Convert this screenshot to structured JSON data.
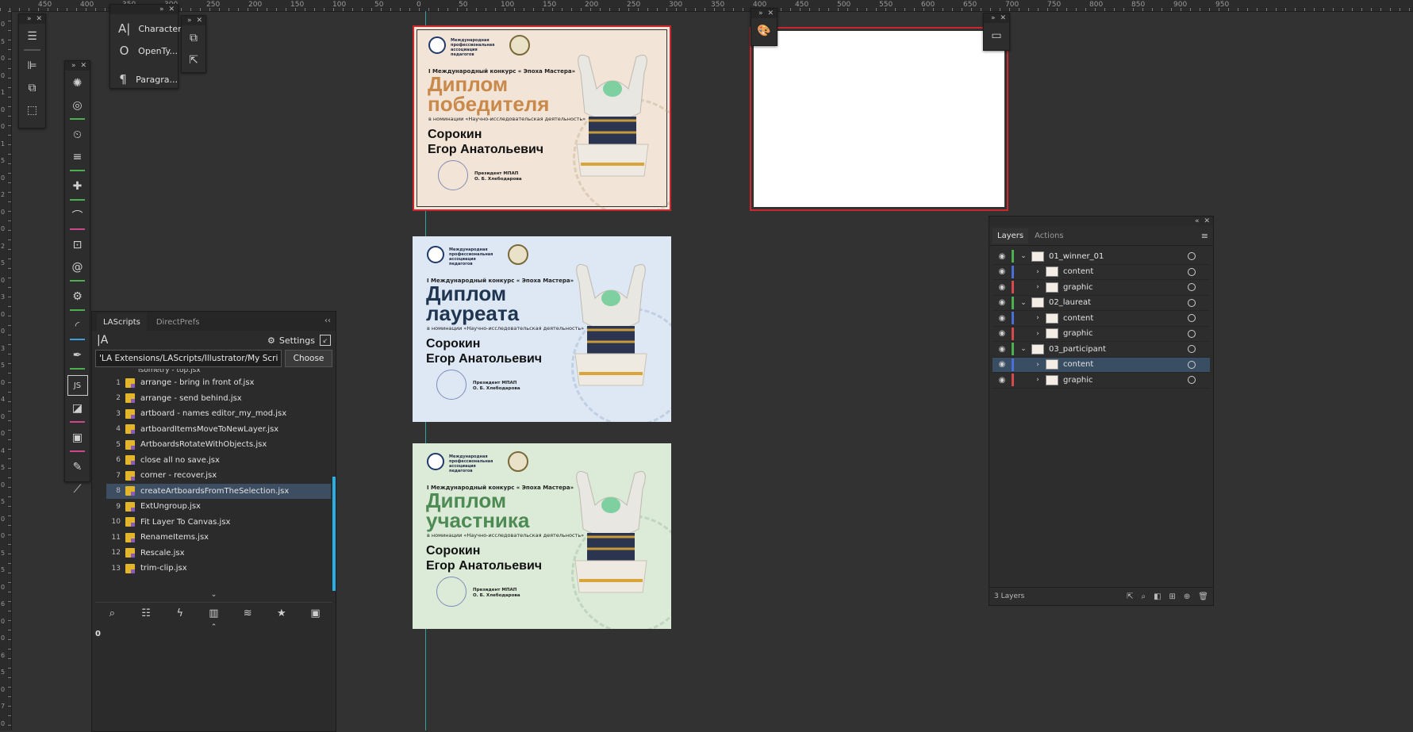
{
  "ruler": {
    "top_labels": [
      "450",
      "400",
      "350",
      "300",
      "250",
      "200",
      "150",
      "100",
      "50",
      "0",
      "50",
      "100",
      "150",
      "200",
      "250",
      "300",
      "350",
      "400",
      "450",
      "500",
      "550",
      "600",
      "650",
      "700",
      "750",
      "800",
      "850",
      "900",
      "950"
    ],
    "left_labels": [
      "0",
      "5",
      "0",
      "0",
      "1",
      "0",
      "0",
      "1",
      "5",
      "0",
      "2",
      "0",
      "0",
      "2",
      "5",
      "0",
      "3",
      "0",
      "0",
      "3",
      "5",
      "0",
      "4",
      "0",
      "0",
      "4",
      "5",
      "0",
      "5",
      "0",
      "0",
      "5",
      "5",
      "0",
      "6",
      "0",
      "0",
      "6",
      "5",
      "0",
      "7",
      "0"
    ]
  },
  "type_panel": {
    "items": [
      {
        "icon": "A|",
        "label": "Character"
      },
      {
        "icon": "O",
        "label": "OpenTy..."
      },
      {
        "icon": "¶",
        "label": "Paragra..."
      }
    ]
  },
  "artboards": [
    {
      "contest": "I Международный конкурс « Эпоха Мастера»",
      "title_line1": "Диплом",
      "title_line2": "победителя",
      "title_color": "#c8894a",
      "bg": "#f2e4d6",
      "nomination": "в номинации «Научно-исследовательская деятельность»",
      "name_line1": "Сорокин",
      "name_line2": "Егор Анатольевич",
      "sig_role": "Президент МПАП",
      "sig_name": "О. Б. Хлебодарова",
      "org": "Международная профессиональная ассоциация педагогов"
    },
    {
      "contest": "I Международный конкурс « Эпоха Мастера»",
      "title_line1": "Диплом",
      "title_line2": "лауреата",
      "title_color": "#1f3550",
      "bg": "#dde8f4",
      "nomination": "в номинации «Научно-исследовательская деятельность»",
      "name_line1": "Сорокин",
      "name_line2": "Егор Анатольевич",
      "sig_role": "Президент МПАП",
      "sig_name": "О. Б. Хлебодарова",
      "org": "Международная профессиональная ассоциация педагогов"
    },
    {
      "contest": "I Международный конкурс « Эпоха Мастера»",
      "title_line1": "Диплом",
      "title_line2": "участника",
      "title_color": "#4e8a54",
      "bg": "#dcebd8",
      "nomination": "в номинации «Научно-исследовательская деятельность»",
      "name_line1": "Сорокин",
      "name_line2": "Егор Анатольевич",
      "sig_role": "Президент МПАП",
      "sig_name": "О. Б. Хлебодарова",
      "org": "Международная профессиональная ассоциация педагогов"
    }
  ],
  "lascripts": {
    "tabs": [
      "LAScripts",
      "DirectPrefs"
    ],
    "settings_label": "Settings",
    "path_value": "'LA Extensions/LAScripts/Illustrator/My Scripts",
    "choose_label": "Choose",
    "partial_item": "isometry - top.jsx",
    "scripts": [
      {
        "num": "1",
        "name": "arrange - bring in front of.jsx"
      },
      {
        "num": "2",
        "name": "arrange - send behind.jsx"
      },
      {
        "num": "3",
        "name": "artboard - names editor_my_mod.jsx"
      },
      {
        "num": "4",
        "name": "artboardItemsMoveToNewLayer.jsx"
      },
      {
        "num": "5",
        "name": "ArtboardsRotateWithObjects.jsx"
      },
      {
        "num": "6",
        "name": "close all no save.jsx"
      },
      {
        "num": "7",
        "name": "corner - recover.jsx"
      },
      {
        "num": "8",
        "name": "createArtboardsFromTheSelection.jsx"
      },
      {
        "num": "9",
        "name": "ExtUngroup.jsx"
      },
      {
        "num": "10",
        "name": "Fit Layer To Canvas.jsx"
      },
      {
        "num": "11",
        "name": "RenameItems.jsx"
      },
      {
        "num": "12",
        "name": "Rescale.jsx"
      },
      {
        "num": "13",
        "name": "trim-clip.jsx"
      }
    ],
    "selected_index": 7,
    "status_value": "0"
  },
  "layers_panel": {
    "tabs": [
      "Layers",
      "Actions"
    ],
    "rows": [
      {
        "name": "01_winner_01",
        "level": 0,
        "expanded": true,
        "color": "#4caf50"
      },
      {
        "name": "content",
        "level": 1,
        "expanded": false,
        "color": "#4a6fd8"
      },
      {
        "name": "graphic",
        "level": 1,
        "expanded": false,
        "color": "#d84a4a"
      },
      {
        "name": "02_laureat",
        "level": 0,
        "expanded": true,
        "color": "#4caf50"
      },
      {
        "name": "content",
        "level": 1,
        "expanded": false,
        "color": "#4a6fd8"
      },
      {
        "name": "graphic",
        "level": 1,
        "expanded": false,
        "color": "#d84a4a"
      },
      {
        "name": "03_participant",
        "level": 0,
        "expanded": true,
        "color": "#4caf50"
      },
      {
        "name": "content",
        "level": 1,
        "expanded": false,
        "color": "#4a6fd8"
      },
      {
        "name": "graphic",
        "level": 1,
        "expanded": false,
        "color": "#d84a4a"
      }
    ],
    "selected_index": 7,
    "count_label": "3 Layers"
  }
}
